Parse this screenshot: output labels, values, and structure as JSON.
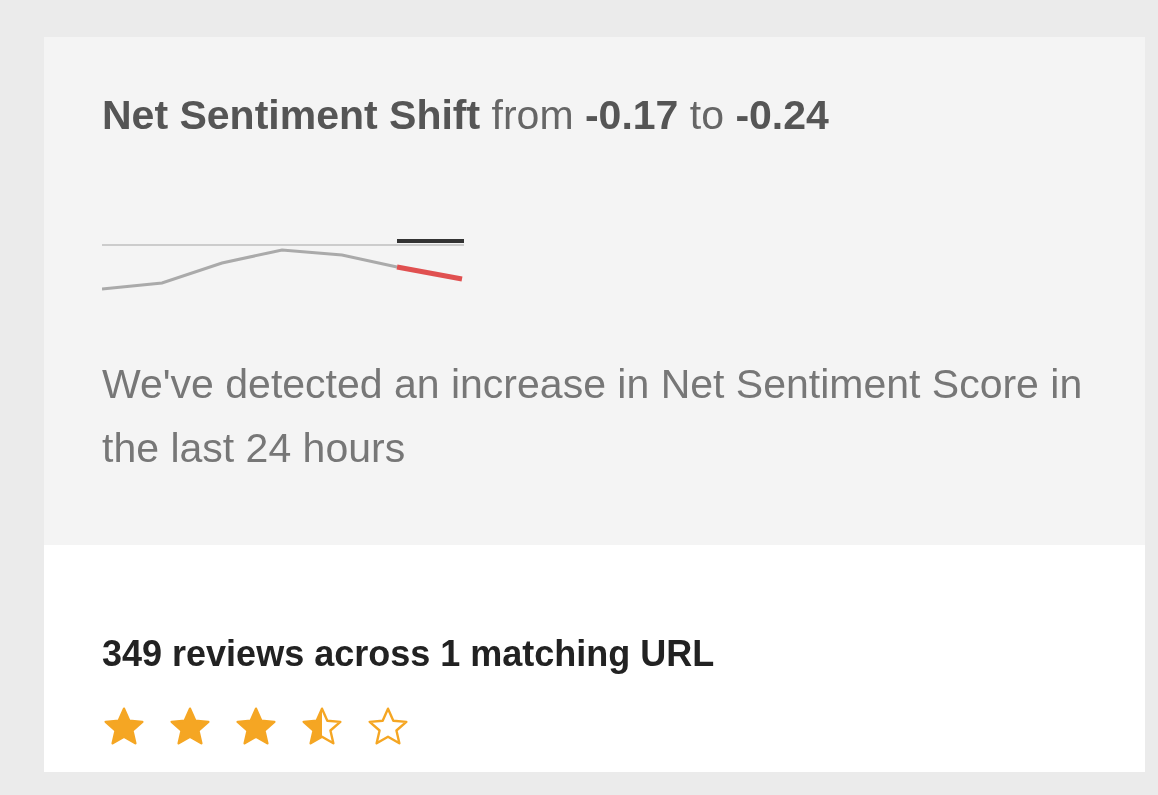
{
  "card": {
    "title": "**Net Sentiment Shift** from **-0.17** to **-0.24**",
    "description": "We've detected an increase in Net Sentiment Score in the last 24 hours",
    "reviews": "349 reviews across 1 matching URL",
    "stars": 3.5
  }
}
